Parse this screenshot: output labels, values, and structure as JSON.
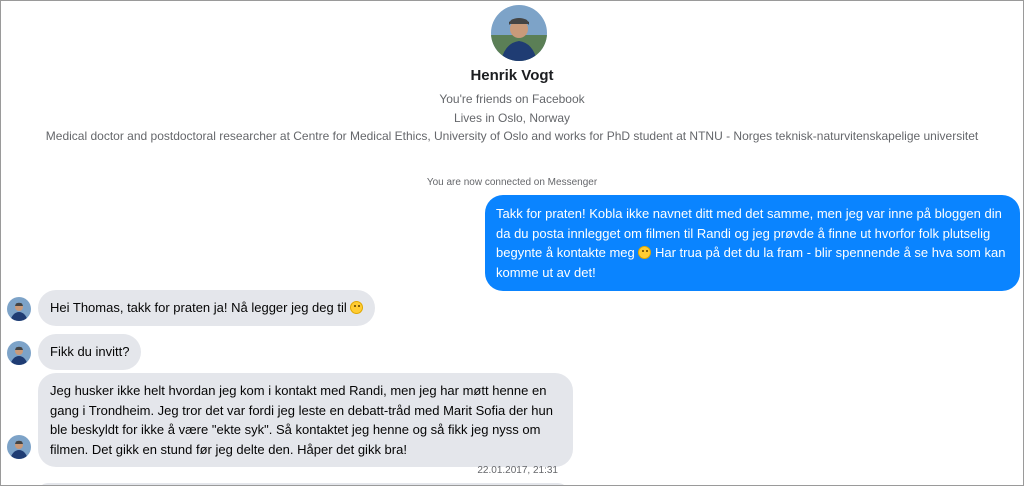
{
  "profile": {
    "name": "Henrik Vogt",
    "friends_line": "You're friends on Facebook",
    "location_line": "Lives in Oslo, Norway",
    "work_line": "Medical doctor and postdoctoral researcher at Centre for Medical Ethics, University of Oslo and works for PhD student at NTNU - Norges teknisk-naturvitenskapelige universitet",
    "avatar_icon": "profile-photo-icon"
  },
  "conversation": {
    "connected_notice": "You are now connected on Messenger",
    "outgoing": [
      {
        "text_before_emoji": "Takk for praten! Kobla ikke navnet ditt med det samme, men jeg var inne på bloggen din da du posta innlegget om filmen til Randi og jeg prøvde å finne ut hvorfor folk plutselig begynte å kontakte meg ",
        "emoji": "embarrassed-emoji",
        "text_after_emoji": " Har trua på det du la fram - blir spennende å se hva som kan komme ut av det!"
      }
    ],
    "incoming": [
      {
        "text": "Hei Thomas, takk for praten ja! Nå legger jeg deg til ",
        "emoji": "smile-emoji"
      },
      {
        "text": "Fikk du invitt?"
      },
      {
        "text": "Jeg husker ikke helt hvordan jeg kom i kontakt med Randi, men jeg har møtt henne en gang i Trondheim. Jeg tror det var fordi jeg leste en debatt-tråd med Marit Sofia der hun ble beskyldt for ikke å være \"ekte syk\". Så kontaktet jeg henne og så fikk jeg nyss om filmen. Det gikk en stund før jeg delte den. Håper det gikk bra!"
      }
    ],
    "timestamp": "22.01.2017, 21:31"
  },
  "colors": {
    "outgoing_bubble": "#0a84ff",
    "incoming_bubble": "#e4e6eb",
    "secondary_text": "#65676b"
  }
}
